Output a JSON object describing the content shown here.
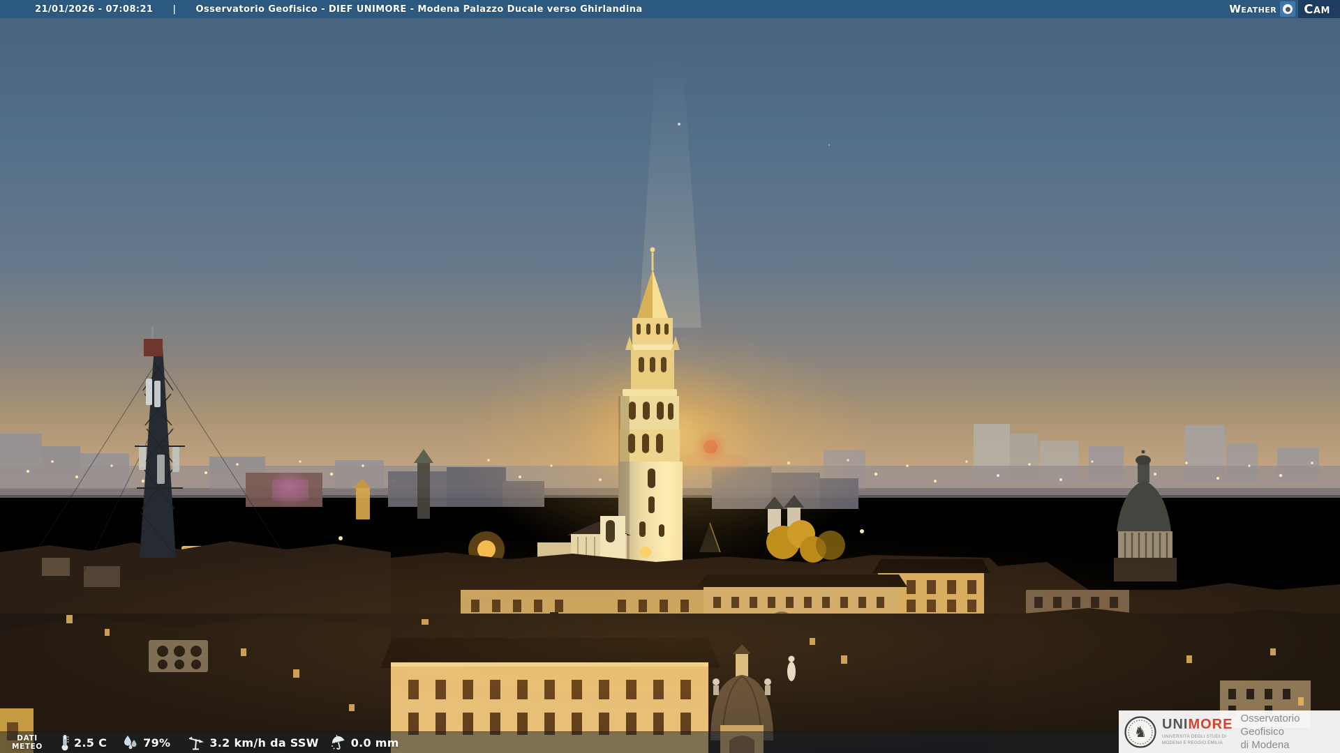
{
  "colors": {
    "topbar-bg": "#2d5a80",
    "cam-box-bg": "#1c3c60",
    "lens-box-bg": "#3f76ab",
    "bottombar-bg": "rgba(22,32,44,0.5)",
    "logo-box-bg": "rgba(255,255,255,0.93)",
    "unimore-gray": "#555555",
    "unimore-red": "#d5432d",
    "logo-text-gray": "#8a8a8a",
    "overlay-text": "#ffffff"
  },
  "topbar": {
    "timestamp": "21/01/2026 - 07:08:21",
    "separator": "|",
    "title": "Osservatorio Geofisico - DIEF UNIMORE - Modena Palazzo Ducale verso Ghirlandina",
    "brand": {
      "weather": "Weather",
      "cam": "Cam"
    }
  },
  "weatherbar": {
    "label_line1": "DATI",
    "label_line2": "METEO",
    "temperature": "2.5 C",
    "humidity": "79%",
    "wind": "3.2 km/h da SSW",
    "rain": "0.0 mm"
  },
  "logo": {
    "acronym_uni": "UNI",
    "acronym_more": "MORE",
    "subtitle_line1": "UNIVERSITÀ DEGLI STUDI DI",
    "subtitle_line2": "MODENA E REGGIO EMILIA",
    "name_line1": "Osservatorio Geofisico",
    "name_line2": "di Modena"
  },
  "icons": {
    "temperature": "thermometer",
    "humidity": "water-drops",
    "wind": "wind-vane",
    "rain": "umbrella",
    "brand_lens": "camera-lens",
    "seal": "unimore-knight-seal"
  }
}
